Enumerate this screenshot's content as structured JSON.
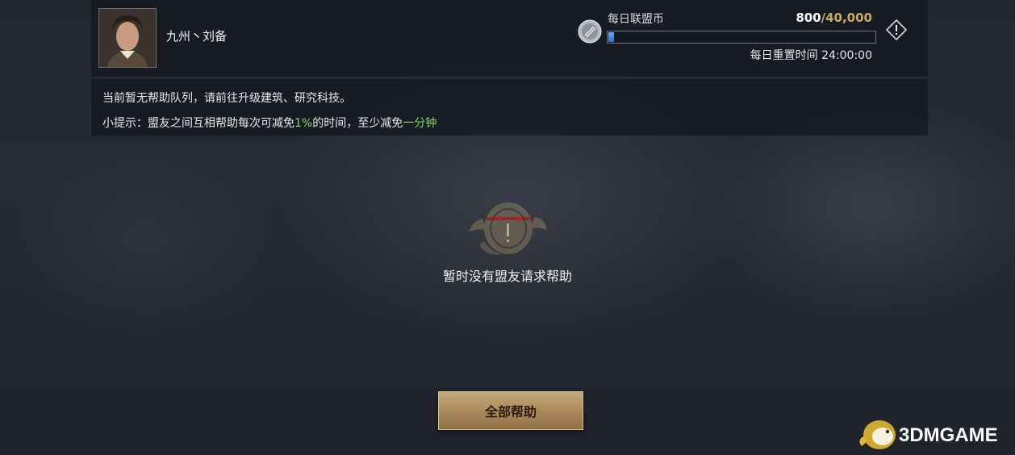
{
  "player": {
    "name": "九州丶刘备",
    "avatar": "avatar-portrait"
  },
  "alliance_coin": {
    "label": "每日联盟币",
    "current": "800",
    "separator": "/",
    "max": "40,000",
    "progress_fraction": 0.02,
    "reset_text": "每日重置时间 24:00:00",
    "icon": "silver-coin-icon"
  },
  "info_button": {
    "icon": "exclamation-diamond-icon"
  },
  "tips": {
    "line1": "当前暂无帮助队列，请前往升级建筑、研究科技。",
    "line2_prefix": "小提示：盟友之间互相帮助每次可减免",
    "line2_percent": "1%",
    "line2_middle": "的时间，至少减免",
    "line2_min": "一分钟"
  },
  "empty_state": {
    "icon": "empty-mascot-icon",
    "text": "暂时没有盟友请求帮助"
  },
  "actions": {
    "help_all_label": "全部帮助"
  },
  "watermark": {
    "text": "3DMGAME"
  },
  "colors": {
    "accent_gold": "#c8a968",
    "highlight_green": "#7fdc5a",
    "progress_blue": "#2f6fd1"
  }
}
